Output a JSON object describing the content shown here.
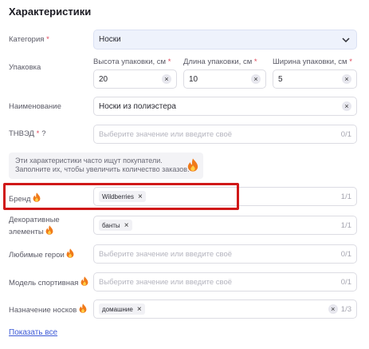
{
  "section_title": "Характеристики",
  "category": {
    "label": "Категория",
    "required": "*",
    "value": "Носки"
  },
  "packaging": {
    "label": "Упаковка",
    "height": {
      "label": "Высота упаковки, см",
      "required": "*",
      "value": "20"
    },
    "length": {
      "label": "Длина упаковки, см",
      "required": "*",
      "value": "10"
    },
    "width": {
      "label": "Ширина упаковки, см",
      "required": "*",
      "value": "5"
    }
  },
  "name": {
    "label": "Наименование",
    "value": "Носки из полиэстера"
  },
  "tnved": {
    "label": "ТНВЭД",
    "required": "*",
    "help": "?",
    "placeholder": "Выберите значение или введите своё",
    "counter": "0/1"
  },
  "hint": {
    "line1": "Эти характеристики часто ищут покупатели.",
    "line2": "Заполните их, чтобы увеличить количество заказов."
  },
  "brand": {
    "label": "Бренд",
    "chip": "Wildberries",
    "counter": "1/1"
  },
  "decor": {
    "label_line1": "Декоративные",
    "label_line2": "элементы",
    "chip": "банты",
    "counter": "1/1"
  },
  "heroes": {
    "label": "Любимые герои",
    "placeholder": "Выберите значение или введите своё",
    "counter": "0/1"
  },
  "sport_model": {
    "label": "Модель спортивная",
    "placeholder": "Выберите значение или введите своё",
    "counter": "0/1"
  },
  "socks_purpose": {
    "label": "Назначение носков",
    "chip": "домашние",
    "counter": "1/3"
  },
  "show_all": "Показать все",
  "icons": {
    "clear": "×",
    "chip_remove": "×"
  },
  "colors": {
    "accent_link": "#3d5ad6",
    "required": "#e0455a",
    "highlight": "#d01818",
    "flame": "#f07a1a"
  }
}
